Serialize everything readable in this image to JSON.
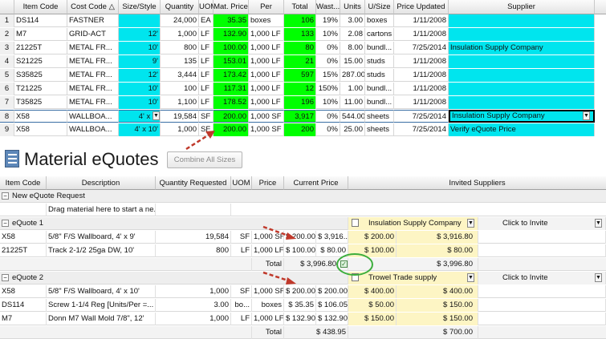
{
  "top_grid": {
    "headers": [
      "Item Code",
      "Cost Code",
      "Size/Style",
      "Quantity",
      "UOM",
      "Mat. Price",
      "Per",
      "Total",
      "Wast...",
      "Units",
      "U/Size",
      "Price Updated",
      "Supplier"
    ],
    "sort_glyph": "△",
    "rows": [
      {
        "n": "1",
        "item": "DS114",
        "cost": "FASTNER",
        "size": "",
        "qty": "24,000",
        "uom": "EA",
        "price": "35.35",
        "per": "boxes",
        "total": "106",
        "waste": "19%",
        "units": "3.00",
        "usize": "boxes",
        "updated": "1/11/2008",
        "supplier": ""
      },
      {
        "n": "2",
        "item": "M7",
        "cost": "GRID-ACT",
        "size": "12'",
        "qty": "1,000",
        "uom": "LF",
        "price": "132.90",
        "per": "1,000 LF",
        "total": "133",
        "waste": "10%",
        "units": "2.08",
        "usize": "cartons",
        "updated": "1/11/2008",
        "supplier": ""
      },
      {
        "n": "3",
        "item": "21225T",
        "cost": "METAL FR...",
        "size": "10'",
        "qty": "800",
        "uom": "LF",
        "price": "100.00",
        "per": "1,000 LF",
        "total": "80",
        "waste": "0%",
        "units": "8.00",
        "usize": "bundl...",
        "updated": "7/25/2014",
        "supplier": "Insulation Supply Company"
      },
      {
        "n": "4",
        "item": "S21225",
        "cost": "METAL FR...",
        "size": "9'",
        "qty": "135",
        "uom": "LF",
        "price": "153.01",
        "per": "1,000 LF",
        "total": "21",
        "waste": "0%",
        "units": "15.00",
        "usize": "studs",
        "updated": "1/11/2008",
        "supplier": ""
      },
      {
        "n": "5",
        "item": "S35825",
        "cost": "METAL FR...",
        "size": "12'",
        "qty": "3,444",
        "uom": "LF",
        "price": "173.42",
        "per": "1,000 LF",
        "total": "597",
        "waste": "15%",
        "units": "287.00",
        "usize": "studs",
        "updated": "1/11/2008",
        "supplier": ""
      },
      {
        "n": "6",
        "item": "T21225",
        "cost": "METAL FR...",
        "size": "10'",
        "qty": "100",
        "uom": "LF",
        "price": "117.31",
        "per": "1,000 LF",
        "total": "12",
        "waste": "150%",
        "units": "1.00",
        "usize": "bundl...",
        "updated": "1/11/2008",
        "supplier": ""
      },
      {
        "n": "7",
        "item": "T35825",
        "cost": "METAL FR...",
        "size": "10'",
        "qty": "1,100",
        "uom": "LF",
        "price": "178.52",
        "per": "1,000 LF",
        "total": "196",
        "waste": "10%",
        "units": "11.00",
        "usize": "bundl...",
        "updated": "1/11/2008",
        "supplier": ""
      },
      {
        "n": "8",
        "item": "X58",
        "cost": "WALLBOA...",
        "size": "4' x 9'",
        "qty": "19,584",
        "uom": "SF",
        "price": "200.00",
        "per": "1,000 SF",
        "total": "3,917",
        "waste": "0%",
        "units": "544.00",
        "usize": "sheets",
        "updated": "7/25/2014",
        "supplier": "Insulation Supply Company"
      },
      {
        "n": "9",
        "item": "X58",
        "cost": "WALLBOA...",
        "size": "4' x 10'",
        "qty": "1,000",
        "uom": "SF",
        "price": "200.00",
        "per": "1,000 SF",
        "total": "200",
        "waste": "0%",
        "units": "25.00",
        "usize": "sheets",
        "updated": "7/25/2014",
        "supplier": "Verify eQuote Price"
      }
    ]
  },
  "section": {
    "title": "Material eQuotes",
    "combine_button": "Combine All Sizes"
  },
  "bottom_grid": {
    "headers": [
      "Item Code",
      "Description",
      "Quantity Requested",
      "UOM",
      "Price Per",
      "Current Price",
      "Invited Suppliers"
    ],
    "new_request_label": "New eQuote Request",
    "drag_hint": "Drag material here to start a ne...",
    "invite_label": "Click to Invite",
    "total_label": "Total",
    "quote1": {
      "label": "eQuote 1",
      "supplier": "Insulation Supply Company",
      "rows": [
        {
          "item": "X58",
          "desc": "5/8\"  F/S Wallboard, 4' x 9'",
          "qty": "19,584",
          "uom": "SF",
          "per": "1,000 SF",
          "price": "$ 200.00",
          "ext": "$ 3,916...",
          "s_price": "$ 200.00",
          "s_ext": "$ 3,916.80"
        },
        {
          "item": "21225T",
          "desc": "Track 2-1/2  25ga DW, 10'",
          "qty": "800",
          "uom": "LF",
          "per": "1,000 LF",
          "price": "$ 100.00",
          "ext": "$ 80.00",
          "s_price": "$ 100.00",
          "s_ext": "$ 80.00"
        }
      ],
      "total": "$ 3,996.80",
      "s_total": "$ 3,996.80"
    },
    "quote2": {
      "label": "eQuote 2",
      "supplier": "Trowel Trade supply",
      "rows": [
        {
          "item": "X58",
          "desc": "5/8\"  F/S Wallboard, 4' x 10'",
          "qty": "1,000",
          "uom": "SF",
          "per": "1,000 SF",
          "price": "$ 200.00",
          "ext": "$ 200.00",
          "s_price": "$ 400.00",
          "s_ext": "$ 400.00"
        },
        {
          "item": "DS114",
          "desc": "Screw 1-1/4  Reg [Units/Per =...",
          "qty": "3.00",
          "uom": "bo...",
          "per": "boxes",
          "price": "$ 35.35",
          "ext": "$ 106.05",
          "s_price": "$ 50.00",
          "s_ext": "$ 150.00"
        },
        {
          "item": "M7",
          "desc": "Donn M7 Wall Mold 7/8\", 12'",
          "qty": "1,000",
          "uom": "LF",
          "per": "1,000 LF",
          "price": "$ 132.90",
          "ext": "$ 132.90",
          "s_price": "$ 150.00",
          "s_ext": "$ 150.00"
        }
      ],
      "total": "$ 438.95",
      "s_total": "$ 700.00"
    }
  },
  "colors": {
    "cyan": "#00e5ee",
    "green": "#00ff00",
    "arrow": "#c0392b",
    "circle": "#3cae3c",
    "yellow": "#fdf5c4"
  }
}
